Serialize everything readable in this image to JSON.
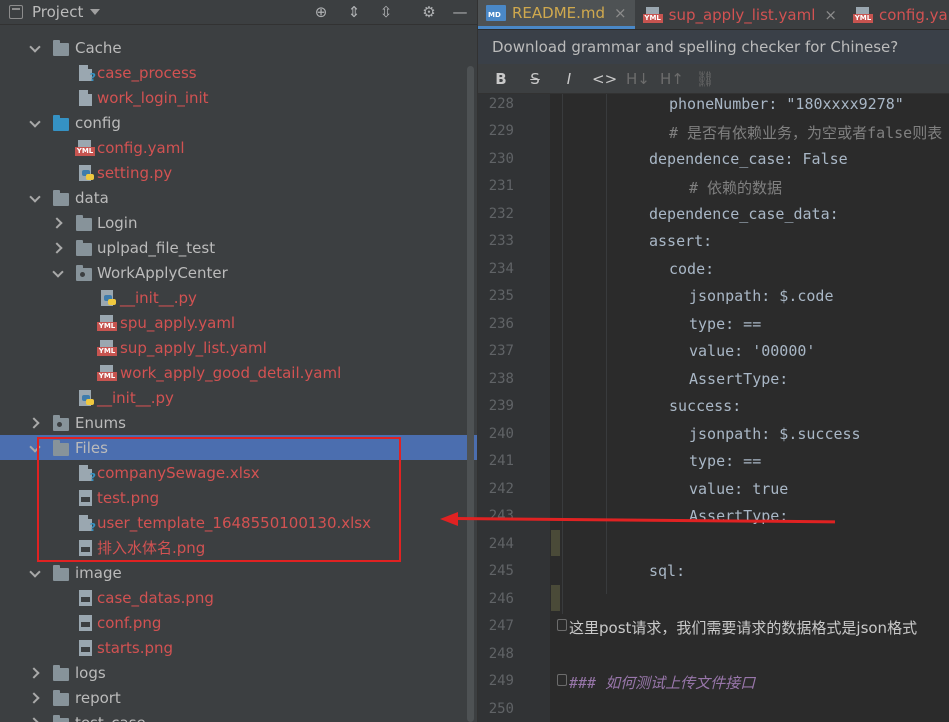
{
  "project_panel": {
    "title": "Project",
    "toolbar_icons": [
      "crosshair-icon",
      "expand-all-icon",
      "collapse-all-icon",
      "gear-icon",
      "minimize-icon"
    ],
    "tree": [
      {
        "label": "Cache",
        "type": "folder",
        "expanded": true
      },
      {
        "label": "case_process",
        "type": "file-unknown"
      },
      {
        "label": "work_login_init",
        "type": "file-generic"
      },
      {
        "label": "config",
        "type": "folder-blue",
        "expanded": true
      },
      {
        "label": "config.yaml",
        "type": "file-yml"
      },
      {
        "label": "setting.py",
        "type": "file-py"
      },
      {
        "label": "data",
        "type": "folder",
        "expanded": true
      },
      {
        "label": "Login",
        "type": "folder",
        "expanded": false
      },
      {
        "label": "uplpad_file_test",
        "type": "folder",
        "expanded": false
      },
      {
        "label": "WorkApplyCenter",
        "type": "folder-dot",
        "expanded": true
      },
      {
        "label": "__init__.py",
        "type": "file-py"
      },
      {
        "label": "spu_apply.yaml",
        "type": "file-yml"
      },
      {
        "label": "sup_apply_list.yaml",
        "type": "file-yml"
      },
      {
        "label": "work_apply_good_detail.yaml",
        "type": "file-yml"
      },
      {
        "label": "__init__.py",
        "type": "file-py"
      },
      {
        "label": "Enums",
        "type": "folder-dot",
        "expanded": false
      },
      {
        "label": "Files",
        "type": "folder",
        "expanded": true,
        "selected": true
      },
      {
        "label": "companySewage.xlsx",
        "type": "file-unknown"
      },
      {
        "label": "test.png",
        "type": "file-img"
      },
      {
        "label": "user_template_1648550100130.xlsx",
        "type": "file-unknown"
      },
      {
        "label": "排入水体名.png",
        "type": "file-img"
      },
      {
        "label": "image",
        "type": "folder",
        "expanded": true
      },
      {
        "label": "case_datas.png",
        "type": "file-img"
      },
      {
        "label": "conf.png",
        "type": "file-img"
      },
      {
        "label": "starts.png",
        "type": "file-img"
      },
      {
        "label": "logs",
        "type": "folder",
        "expanded": false
      },
      {
        "label": "report",
        "type": "folder",
        "expanded": false
      },
      {
        "label": "test_case",
        "type": "folder",
        "expanded": false
      }
    ]
  },
  "editor": {
    "tabs": [
      {
        "label": "README.md",
        "icon": "markdown-icon",
        "active": true
      },
      {
        "label": "sup_apply_list.yaml",
        "icon": "yaml-icon",
        "active": false
      },
      {
        "label": "config.yam",
        "icon": "yaml-icon",
        "active": false
      }
    ],
    "notice": "Download grammar and spelling checker for Chinese?",
    "toolbar": [
      "B",
      "S",
      "I",
      "<>",
      "H↓",
      "H↑",
      "link"
    ],
    "lines": [
      {
        "n": "228",
        "text": "phoneNumber: \"180xxxx9278\"",
        "cls": "code"
      },
      {
        "n": "229",
        "text": "# 是否有依赖业务，为空或者false则表",
        "cls": "comment"
      },
      {
        "n": "230",
        "text": "dependence_case: False",
        "cls": "code"
      },
      {
        "n": "231",
        "text": "# 依赖的数据",
        "cls": "comment"
      },
      {
        "n": "232",
        "text": "dependence_case_data:",
        "cls": "code"
      },
      {
        "n": "233",
        "text": "assert:",
        "cls": "code"
      },
      {
        "n": "234",
        "text": "code:",
        "cls": "code"
      },
      {
        "n": "235",
        "text": "jsonpath: $.code",
        "cls": "code"
      },
      {
        "n": "236",
        "text": "type: ==",
        "cls": "code"
      },
      {
        "n": "237",
        "text": "value: '00000'",
        "cls": "code"
      },
      {
        "n": "238",
        "text": "AssertType:",
        "cls": "code"
      },
      {
        "n": "239",
        "text": "success:",
        "cls": "code"
      },
      {
        "n": "240",
        "text": "jsonpath: $.success",
        "cls": "code"
      },
      {
        "n": "241",
        "text": "type: ==",
        "cls": "code"
      },
      {
        "n": "242",
        "text": "value: true",
        "cls": "code"
      },
      {
        "n": "243",
        "text": "AssertType:",
        "cls": "code"
      },
      {
        "n": "244",
        "text": "",
        "cls": "code"
      },
      {
        "n": "245",
        "text": "sql:",
        "cls": "code"
      },
      {
        "n": "246",
        "text": "",
        "cls": "code"
      },
      {
        "n": "247",
        "text": "这里post请求，我们需要请求的数据格式是json格式",
        "cls": "text"
      },
      {
        "n": "248",
        "text": "",
        "cls": "code"
      },
      {
        "n": "249",
        "text": "### 如何测试上传文件接口",
        "cls": "heading"
      },
      {
        "n": "250",
        "text": "",
        "cls": "code"
      }
    ]
  },
  "colors": {
    "panel_bg": "#3c3f41",
    "editor_bg": "#2b2b2b",
    "selection": "#4b6eaf",
    "file_red": "#d25252",
    "annotation_red": "#e02222"
  }
}
